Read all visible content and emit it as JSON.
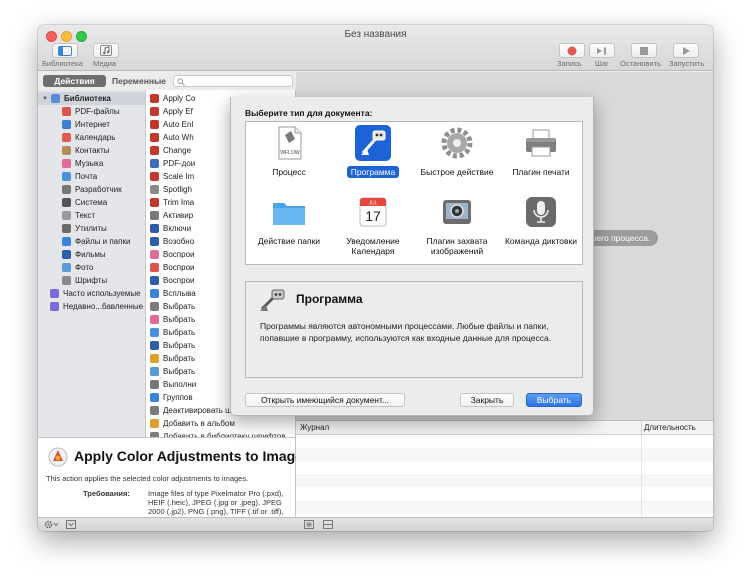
{
  "window": {
    "title": "Без названия"
  },
  "toolbar": {
    "left": [
      {
        "label": "Библиотека"
      },
      {
        "label": "Медиа"
      }
    ],
    "right": [
      {
        "label": "Запись"
      },
      {
        "label": "Шаг"
      },
      {
        "label": "Остановить"
      },
      {
        "label": "Запустить"
      }
    ]
  },
  "tabs": {
    "actions": "Действия",
    "variables": "Переменные"
  },
  "library": {
    "items": [
      {
        "label": "Библиотека",
        "icon": "library-folder-icon",
        "color": "#5a8bd6"
      },
      {
        "label": "PDF-файлы",
        "icon": "pdf-icon",
        "color": "#d9534f"
      },
      {
        "label": "Интернет",
        "icon": "globe-icon",
        "color": "#3f7fd1"
      },
      {
        "label": "Календарь",
        "icon": "calendar-icon",
        "color": "#e35b4f"
      },
      {
        "label": "Контакты",
        "icon": "contacts-icon",
        "color": "#b58c5a"
      },
      {
        "label": "Музыка",
        "icon": "music-icon",
        "color": "#e06b9a"
      },
      {
        "label": "Почта",
        "icon": "mail-icon",
        "color": "#4a8fe0"
      },
      {
        "label": "Разработчик",
        "icon": "hammer-icon",
        "color": "#777777"
      },
      {
        "label": "Система",
        "icon": "system-icon",
        "color": "#555555"
      },
      {
        "label": "Текст",
        "icon": "text-icon",
        "color": "#9a9a9a"
      },
      {
        "label": "Утилиты",
        "icon": "utilities-icon",
        "color": "#6a6a6a"
      },
      {
        "label": "Файлы и папки",
        "icon": "finder-icon",
        "color": "#3b82d8"
      },
      {
        "label": "Фильмы",
        "icon": "movies-icon",
        "color": "#2c5fa8"
      },
      {
        "label": "Фото",
        "icon": "photos-icon",
        "color": "#5b9bd5"
      },
      {
        "label": "Шрифты",
        "icon": "fonts-icon",
        "color": "#8a8a8a"
      },
      {
        "label": "Часто используемые",
        "icon": "smart-folder-icon",
        "color": "#7b68d9"
      },
      {
        "label": "Недавно...бавленные",
        "icon": "smart-folder-icon",
        "color": "#7b68d9"
      }
    ]
  },
  "actions": {
    "items": [
      {
        "label": "Apply Co",
        "color": "#c0392b"
      },
      {
        "label": "Apply Ef",
        "color": "#c0392b"
      },
      {
        "label": "Auto Enl",
        "color": "#c0392b"
      },
      {
        "label": "Auto Wh",
        "color": "#c0392b"
      },
      {
        "label": "Change",
        "color": "#c0392b"
      },
      {
        "label": "PDF-дои",
        "color": "#3a6db5"
      },
      {
        "label": "Scale Im",
        "color": "#c0392b"
      },
      {
        "label": "Spotligh",
        "color": "#8a8a8a"
      },
      {
        "label": "Trim Ima",
        "color": "#c0392b"
      },
      {
        "label": "Активир",
        "color": "#7a7a7a"
      },
      {
        "label": "Включи",
        "color": "#2c5fa8"
      },
      {
        "label": "Возобно",
        "color": "#2c5fa8"
      },
      {
        "label": "Воспрои",
        "color": "#e06b9a"
      },
      {
        "label": "Воспрои",
        "color": "#d9534f"
      },
      {
        "label": "Воспрои",
        "color": "#2c5fa8"
      },
      {
        "label": "Всплыва",
        "color": "#3b82d8"
      },
      {
        "label": "Выбрать",
        "color": "#7a7a7a"
      },
      {
        "label": "Выбрать",
        "color": "#e06b9a"
      },
      {
        "label": "Выбрать",
        "color": "#4a8fe0"
      },
      {
        "label": "Выбрать",
        "color": "#2c5fa8"
      },
      {
        "label": "Выбрать",
        "color": "#e0a030"
      },
      {
        "label": "Выбрать",
        "color": "#5b9bd5"
      },
      {
        "label": "Выполни",
        "color": "#777777"
      },
      {
        "label": "Группов",
        "color": "#3b82d8"
      },
      {
        "label": "Деактивировать шрифты",
        "color": "#7a7a7a"
      },
      {
        "label": "Добавить в альбом",
        "color": "#e0a030"
      },
      {
        "label": "Добавить в библиотеку шрифтов",
        "color": "#7a7a7a"
      }
    ]
  },
  "description": {
    "title": "Apply Color Adjustments to Images",
    "text": "This action applies the selected color adjustments to images.",
    "requirements_label": "Требования:",
    "requirements_lines": [
      "Image files of type Pixelmator Pro (.pxd),",
      "HEIF (.heic), JPEG (.jpg or .jpeg), JPEG",
      "2000 (.jp2), PNG (.png), TIFF (.tif or .tiff),"
    ]
  },
  "workflow": {
    "hint": "ания Вашего процесса."
  },
  "log": {
    "col_log": "Журнал",
    "col_duration": "Длительность"
  },
  "sheet": {
    "title": "Выберите тип для документа:",
    "types": [
      {
        "label": "Процесс",
        "icon": "workflow-document-icon",
        "icon_text": "WFLOW"
      },
      {
        "label": "Программа",
        "icon": "automator-robot-icon",
        "selected": true
      },
      {
        "label": "Быстрое действие",
        "icon": "gear-icon"
      },
      {
        "label": "Плагин печати",
        "icon": "printer-icon"
      },
      {
        "label": "Действие папки",
        "icon": "folder-icon"
      },
      {
        "label": "Уведомление Календаря",
        "icon": "calendar-icon",
        "icon_text": "17",
        "icon_month": "JUL"
      },
      {
        "label": "Плагин захвата изображений",
        "icon": "image-capture-icon"
      },
      {
        "label": "Команда диктовки",
        "icon": "microphone-icon"
      }
    ],
    "info_title": "Программа",
    "info_text": "Программы являются автономными процессами. Любые файлы и папки, попавшие в программу, используются как входные данные для процесса.",
    "open_existing": "Открыть имеющийся документ...",
    "close": "Закрыть",
    "choose": "Выбрать"
  },
  "colors": {
    "accent": "#1e63d6",
    "primary_button": "#3a7ee8"
  }
}
